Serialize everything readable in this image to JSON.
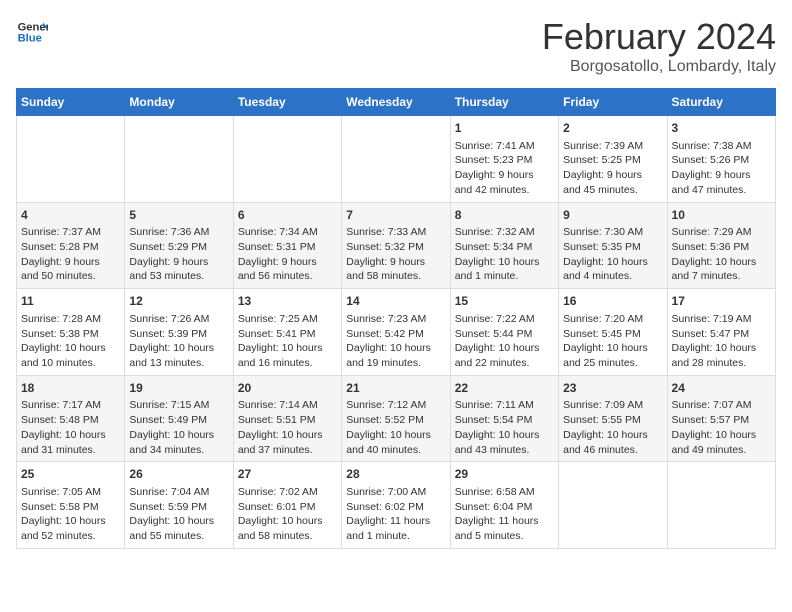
{
  "header": {
    "logo_line1": "General",
    "logo_line2": "Blue",
    "main_title": "February 2024",
    "subtitle": "Borgosatollo, Lombardy, Italy"
  },
  "days_of_week": [
    "Sunday",
    "Monday",
    "Tuesday",
    "Wednesday",
    "Thursday",
    "Friday",
    "Saturday"
  ],
  "weeks": [
    [
      {
        "day": "",
        "content": ""
      },
      {
        "day": "",
        "content": ""
      },
      {
        "day": "",
        "content": ""
      },
      {
        "day": "",
        "content": ""
      },
      {
        "day": "1",
        "content": "Sunrise: 7:41 AM\nSunset: 5:23 PM\nDaylight: 9 hours\nand 42 minutes."
      },
      {
        "day": "2",
        "content": "Sunrise: 7:39 AM\nSunset: 5:25 PM\nDaylight: 9 hours\nand 45 minutes."
      },
      {
        "day": "3",
        "content": "Sunrise: 7:38 AM\nSunset: 5:26 PM\nDaylight: 9 hours\nand 47 minutes."
      }
    ],
    [
      {
        "day": "4",
        "content": "Sunrise: 7:37 AM\nSunset: 5:28 PM\nDaylight: 9 hours\nand 50 minutes."
      },
      {
        "day": "5",
        "content": "Sunrise: 7:36 AM\nSunset: 5:29 PM\nDaylight: 9 hours\nand 53 minutes."
      },
      {
        "day": "6",
        "content": "Sunrise: 7:34 AM\nSunset: 5:31 PM\nDaylight: 9 hours\nand 56 minutes."
      },
      {
        "day": "7",
        "content": "Sunrise: 7:33 AM\nSunset: 5:32 PM\nDaylight: 9 hours\nand 58 minutes."
      },
      {
        "day": "8",
        "content": "Sunrise: 7:32 AM\nSunset: 5:34 PM\nDaylight: 10 hours\nand 1 minute."
      },
      {
        "day": "9",
        "content": "Sunrise: 7:30 AM\nSunset: 5:35 PM\nDaylight: 10 hours\nand 4 minutes."
      },
      {
        "day": "10",
        "content": "Sunrise: 7:29 AM\nSunset: 5:36 PM\nDaylight: 10 hours\nand 7 minutes."
      }
    ],
    [
      {
        "day": "11",
        "content": "Sunrise: 7:28 AM\nSunset: 5:38 PM\nDaylight: 10 hours\nand 10 minutes."
      },
      {
        "day": "12",
        "content": "Sunrise: 7:26 AM\nSunset: 5:39 PM\nDaylight: 10 hours\nand 13 minutes."
      },
      {
        "day": "13",
        "content": "Sunrise: 7:25 AM\nSunset: 5:41 PM\nDaylight: 10 hours\nand 16 minutes."
      },
      {
        "day": "14",
        "content": "Sunrise: 7:23 AM\nSunset: 5:42 PM\nDaylight: 10 hours\nand 19 minutes."
      },
      {
        "day": "15",
        "content": "Sunrise: 7:22 AM\nSunset: 5:44 PM\nDaylight: 10 hours\nand 22 minutes."
      },
      {
        "day": "16",
        "content": "Sunrise: 7:20 AM\nSunset: 5:45 PM\nDaylight: 10 hours\nand 25 minutes."
      },
      {
        "day": "17",
        "content": "Sunrise: 7:19 AM\nSunset: 5:47 PM\nDaylight: 10 hours\nand 28 minutes."
      }
    ],
    [
      {
        "day": "18",
        "content": "Sunrise: 7:17 AM\nSunset: 5:48 PM\nDaylight: 10 hours\nand 31 minutes."
      },
      {
        "day": "19",
        "content": "Sunrise: 7:15 AM\nSunset: 5:49 PM\nDaylight: 10 hours\nand 34 minutes."
      },
      {
        "day": "20",
        "content": "Sunrise: 7:14 AM\nSunset: 5:51 PM\nDaylight: 10 hours\nand 37 minutes."
      },
      {
        "day": "21",
        "content": "Sunrise: 7:12 AM\nSunset: 5:52 PM\nDaylight: 10 hours\nand 40 minutes."
      },
      {
        "day": "22",
        "content": "Sunrise: 7:11 AM\nSunset: 5:54 PM\nDaylight: 10 hours\nand 43 minutes."
      },
      {
        "day": "23",
        "content": "Sunrise: 7:09 AM\nSunset: 5:55 PM\nDaylight: 10 hours\nand 46 minutes."
      },
      {
        "day": "24",
        "content": "Sunrise: 7:07 AM\nSunset: 5:57 PM\nDaylight: 10 hours\nand 49 minutes."
      }
    ],
    [
      {
        "day": "25",
        "content": "Sunrise: 7:05 AM\nSunset: 5:58 PM\nDaylight: 10 hours\nand 52 minutes."
      },
      {
        "day": "26",
        "content": "Sunrise: 7:04 AM\nSunset: 5:59 PM\nDaylight: 10 hours\nand 55 minutes."
      },
      {
        "day": "27",
        "content": "Sunrise: 7:02 AM\nSunset: 6:01 PM\nDaylight: 10 hours\nand 58 minutes."
      },
      {
        "day": "28",
        "content": "Sunrise: 7:00 AM\nSunset: 6:02 PM\nDaylight: 11 hours\nand 1 minute."
      },
      {
        "day": "29",
        "content": "Sunrise: 6:58 AM\nSunset: 6:04 PM\nDaylight: 11 hours\nand 5 minutes."
      },
      {
        "day": "",
        "content": ""
      },
      {
        "day": "",
        "content": ""
      }
    ]
  ]
}
